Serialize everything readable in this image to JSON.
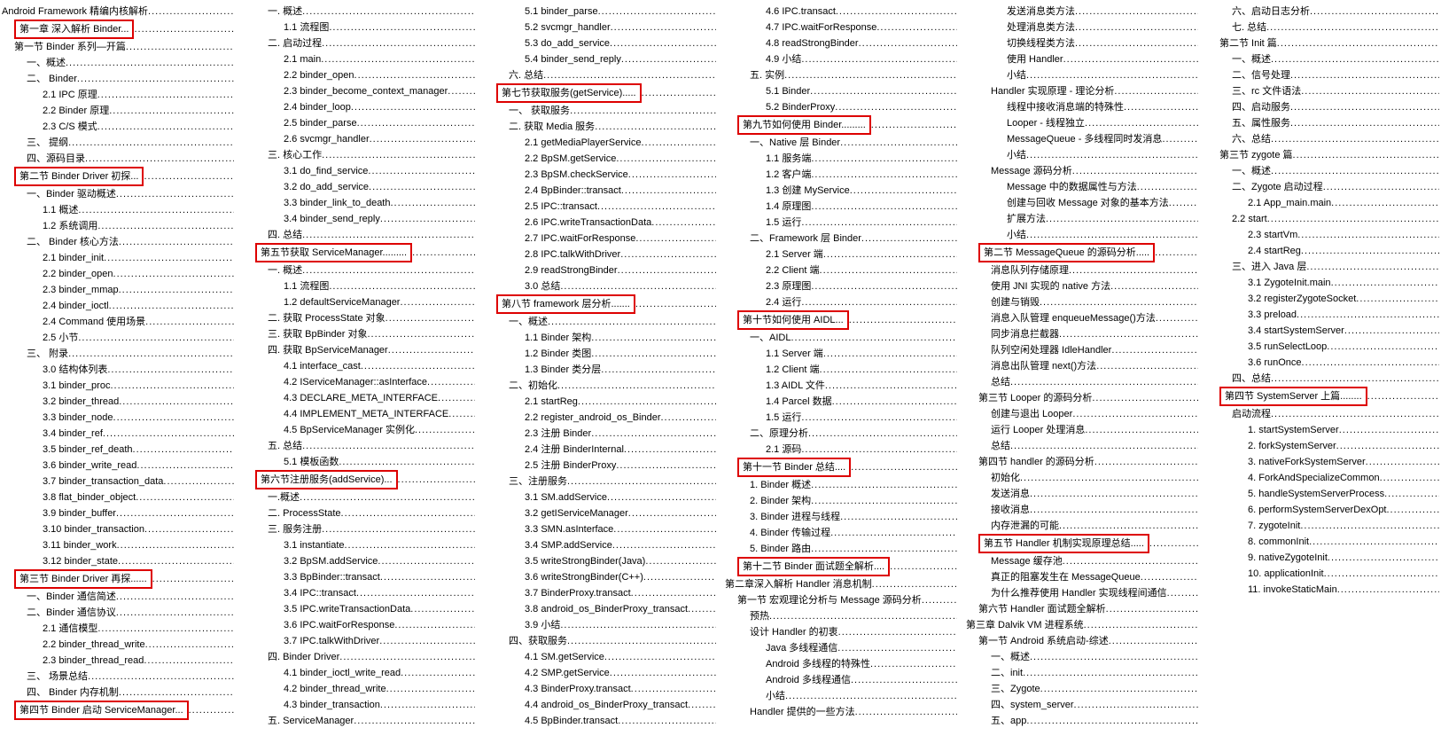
{
  "toc": [
    {
      "t": "Android Framework  精编内核解析",
      "i": 0,
      "h": 0
    },
    {
      "t": "第一章 深入解析 Binder...",
      "i": 1,
      "h": 1
    },
    {
      "t": "第一节 Binder 系列—开篇",
      "i": 1,
      "h": 0
    },
    {
      "t": "一、概述",
      "i": 2,
      "h": 0
    },
    {
      "t": "二、 Binder",
      "i": 2,
      "h": 0
    },
    {
      "t": "2.1 IPC 原理",
      "i": 3,
      "h": 0
    },
    {
      "t": "2.2 Binder 原理",
      "i": 3,
      "h": 0
    },
    {
      "t": "2.3 C/S 模式",
      "i": 3,
      "h": 0
    },
    {
      "t": "三、 提纲",
      "i": 2,
      "h": 0
    },
    {
      "t": "四、源码目录",
      "i": 2,
      "h": 0
    },
    {
      "t": "第二节 Binder Driver 初探...",
      "i": 1,
      "h": 1
    },
    {
      "t": "一、Binder 驱动概述",
      "i": 2,
      "h": 0
    },
    {
      "t": "1.1 概述",
      "i": 3,
      "h": 0
    },
    {
      "t": "1.2  系统调用",
      "i": 3,
      "h": 0
    },
    {
      "t": "二、 Binder 核心方法",
      "i": 2,
      "h": 0
    },
    {
      "t": "2.1 binder_init",
      "i": 3,
      "h": 0
    },
    {
      "t": "2.2 binder_open",
      "i": 3,
      "h": 0
    },
    {
      "t": "2.3 binder_mmap",
      "i": 3,
      "h": 0
    },
    {
      "t": "2.4 binder_ioctl",
      "i": 3,
      "h": 0
    },
    {
      "t": "2.4 Command 使用场景",
      "i": 3,
      "h": 0
    },
    {
      "t": "2.5  小节",
      "i": 3,
      "h": 0
    },
    {
      "t": "三、 附录",
      "i": 2,
      "h": 0
    },
    {
      "t": "3.0 结构体列表",
      "i": 3,
      "h": 0
    },
    {
      "t": "3.1 binder_proc",
      "i": 3,
      "h": 0
    },
    {
      "t": "3.2 binder_thread",
      "i": 3,
      "h": 0
    },
    {
      "t": "3.3 binder_node",
      "i": 3,
      "h": 0
    },
    {
      "t": "3.4 binder_ref",
      "i": 3,
      "h": 0
    },
    {
      "t": "3.5 binder_ref_death",
      "i": 3,
      "h": 0
    },
    {
      "t": "3.6 binder_write_read",
      "i": 3,
      "h": 0
    },
    {
      "t": "3.7 binder_transaction_data",
      "i": 3,
      "h": 0
    },
    {
      "t": "3.8 flat_binder_object",
      "i": 3,
      "h": 0
    },
    {
      "t": "3.9 binder_buffer",
      "i": 3,
      "h": 0
    },
    {
      "t": "3.10 binder_transaction",
      "i": 3,
      "h": 0
    },
    {
      "t": "3.11 binder_work",
      "i": 3,
      "h": 0
    },
    {
      "t": "3.12 binder_state",
      "i": 3,
      "h": 0
    },
    {
      "t": "第三节 Binder Driver 再探......",
      "i": 1,
      "h": 1
    },
    {
      "t": "一、Binder 通信简述",
      "i": 2,
      "h": 0
    },
    {
      "t": "二、Binder 通信协议",
      "i": 2,
      "h": 0
    },
    {
      "t": "2.1 通信模型",
      "i": 3,
      "h": 0
    },
    {
      "t": "2.2 binder_thread_write",
      "i": 3,
      "h": 0
    },
    {
      "t": "2.3 binder_thread_read",
      "i": 3,
      "h": 0
    },
    {
      "t": "三、 场景总结",
      "i": 2,
      "h": 0
    },
    {
      "t": "四、 Binder 内存机制",
      "i": 2,
      "h": 0
    },
    {
      "t": "第四节 Binder 启动 ServiceManager...",
      "i": 1,
      "h": 1
    },
    {
      "t": "一. 概述",
      "i": 2,
      "h": 0
    },
    {
      "t": "1.1 流程图",
      "i": 3,
      "h": 0
    },
    {
      "t": "二. 启动过程",
      "i": 2,
      "h": 0
    },
    {
      "t": "2.1 main",
      "i": 3,
      "h": 0
    },
    {
      "t": "2.2 binder_open",
      "i": 3,
      "h": 0
    },
    {
      "t": "2.3 binder_become_context_manager",
      "i": 3,
      "h": 0
    },
    {
      "t": "2.4 binder_loop",
      "i": 3,
      "h": 0
    },
    {
      "t": "2.5 binder_parse",
      "i": 3,
      "h": 0
    },
    {
      "t": "2.6 svcmgr_handler",
      "i": 3,
      "h": 0
    },
    {
      "t": "三. 核心工作",
      "i": 2,
      "h": 0
    },
    {
      "t": "3.1 do_find_service",
      "i": 3,
      "h": 0
    },
    {
      "t": "3.2 do_add_service",
      "i": 3,
      "h": 0
    },
    {
      "t": "3.3 binder_link_to_death",
      "i": 3,
      "h": 0
    },
    {
      "t": "3.4 binder_send_reply",
      "i": 3,
      "h": 0
    },
    {
      "t": "四. 总结",
      "i": 2,
      "h": 0
    },
    {
      "t": "第五节获取 ServiceManager.........",
      "i": 1,
      "h": 1
    },
    {
      "t": "一. 概述",
      "i": 2,
      "h": 0
    },
    {
      "t": "1.1 流程图",
      "i": 3,
      "h": 0
    },
    {
      "t": "1.2 defaultServiceManager",
      "i": 3,
      "h": 0
    },
    {
      "t": "二. 获取 ProcessState 对象",
      "i": 2,
      "h": 0
    },
    {
      "t": "三. 获取 BpBinder 对象",
      "i": 2,
      "h": 0
    },
    {
      "t": "四. 获取 BpServiceManager",
      "i": 2,
      "h": 0
    },
    {
      "t": "4.1 interface_cast",
      "i": 3,
      "h": 0
    },
    {
      "t": "4.2 IServiceManager::asInterface",
      "i": 3,
      "h": 0
    },
    {
      "t": "4.3 DECLARE_META_INTERFACE",
      "i": 3,
      "h": 0
    },
    {
      "t": "4.4 IMPLEMENT_META_INTERFACE",
      "i": 3,
      "h": 0
    },
    {
      "t": "4.5 BpServiceManager 实例化",
      "i": 3,
      "h": 0
    },
    {
      "t": "五. 总结",
      "i": 2,
      "h": 0
    },
    {
      "t": "5.1 模板函数",
      "i": 3,
      "h": 0
    },
    {
      "t": "第六节注册服务(addService)...",
      "i": 1,
      "h": 1
    },
    {
      "t": "一.概述",
      "i": 2,
      "h": 0
    },
    {
      "t": "二. ProcessState",
      "i": 2,
      "h": 0
    },
    {
      "t": "三. 服务注册",
      "i": 2,
      "h": 0
    },
    {
      "t": "3.1 instantiate",
      "i": 3,
      "h": 0
    },
    {
      "t": "3.2 BpSM.addService",
      "i": 3,
      "h": 0
    },
    {
      "t": "3.3 BpBinder::transact",
      "i": 3,
      "h": 0
    },
    {
      "t": "3.4 IPC::transact",
      "i": 3,
      "h": 0
    },
    {
      "t": "3.5 IPC.writeTransactionData",
      "i": 3,
      "h": 0
    },
    {
      "t": "3.6 IPC.waitForResponse",
      "i": 3,
      "h": 0
    },
    {
      "t": "3.7 IPC.talkWithDriver",
      "i": 3,
      "h": 0
    },
    {
      "t": "四. Binder Driver",
      "i": 2,
      "h": 0
    },
    {
      "t": "4.1 binder_ioctl_write_read",
      "i": 3,
      "h": 0
    },
    {
      "t": "4.2 binder_thread_write",
      "i": 3,
      "h": 0
    },
    {
      "t": "4.3 binder_transaction",
      "i": 3,
      "h": 0
    },
    {
      "t": "五. ServiceManager",
      "i": 2,
      "h": 0
    },
    {
      "t": "5.1 binder_parse",
      "i": 3,
      "h": 0
    },
    {
      "t": "5.2 svcmgr_handler",
      "i": 3,
      "h": 0
    },
    {
      "t": "5.3 do_add_service",
      "i": 3,
      "h": 0
    },
    {
      "t": "5.4 binder_send_reply",
      "i": 3,
      "h": 0
    },
    {
      "t": "六. 总结",
      "i": 2,
      "h": 0
    },
    {
      "t": "第七节获取服务(getService).....",
      "i": 1,
      "h": 1
    },
    {
      "t": "一、 获取服务",
      "i": 2,
      "h": 0
    },
    {
      "t": "二. 获取 Media 服务",
      "i": 2,
      "h": 0
    },
    {
      "t": "2.1 getMediaPlayerService",
      "i": 3,
      "h": 0
    },
    {
      "t": "2.2 BpSM.getService",
      "i": 3,
      "h": 0
    },
    {
      "t": "2.3 BpSM.checkService",
      "i": 3,
      "h": 0
    },
    {
      "t": "2.4 BpBinder::transact",
      "i": 3,
      "h": 0
    },
    {
      "t": "2.5 IPC::transact",
      "i": 3,
      "h": 0
    },
    {
      "t": "2.6 IPC.writeTransactionData",
      "i": 3,
      "h": 0
    },
    {
      "t": "2.7 IPC.waitForResponse",
      "i": 3,
      "h": 0
    },
    {
      "t": "2.8 IPC.talkWithDriver",
      "i": 3,
      "h": 0
    },
    {
      "t": "2.9 readStrongBinder",
      "i": 3,
      "h": 0
    },
    {
      "t": "3.0  总结",
      "i": 3,
      "h": 0
    },
    {
      "t": "第八节 framework 层分析.......",
      "i": 1,
      "h": 1
    },
    {
      "t": "一、概述",
      "i": 2,
      "h": 0
    },
    {
      "t": "1.1 Binder 架构",
      "i": 3,
      "h": 0
    },
    {
      "t": "1.2 Binder 类图",
      "i": 3,
      "h": 0
    },
    {
      "t": "1.3 Binder 类分层",
      "i": 3,
      "h": 0
    },
    {
      "t": "二、初始化",
      "i": 2,
      "h": 0
    },
    {
      "t": "2.1 startReg",
      "i": 3,
      "h": 0
    },
    {
      "t": "2.2 register_android_os_Binder",
      "i": 3,
      "h": 0
    },
    {
      "t": "2.3 注册 Binder",
      "i": 3,
      "h": 0
    },
    {
      "t": "2.4 注册 BinderInternal",
      "i": 3,
      "h": 0
    },
    {
      "t": "2.5 注册 BinderProxy",
      "i": 3,
      "h": 0
    },
    {
      "t": "三、注册服务",
      "i": 2,
      "h": 0
    },
    {
      "t": "3.1 SM.addService",
      "i": 3,
      "h": 0
    },
    {
      "t": "3.2 getIServiceManager",
      "i": 3,
      "h": 0
    },
    {
      "t": "3.3 SMN.asInterface",
      "i": 3,
      "h": 0
    },
    {
      "t": "3.4 SMP.addService",
      "i": 3,
      "h": 0
    },
    {
      "t": "3.5 writeStrongBinder(Java)",
      "i": 3,
      "h": 0
    },
    {
      "t": "3.6 writeStrongBinder(C++)",
      "i": 3,
      "h": 0
    },
    {
      "t": "3.7 BinderProxy.transact",
      "i": 3,
      "h": 0
    },
    {
      "t": "3.8 android_os_BinderProxy_transact",
      "i": 3,
      "h": 0
    },
    {
      "t": "3.9 小结",
      "i": 3,
      "h": 0
    },
    {
      "t": "四、获取服务",
      "i": 2,
      "h": 0
    },
    {
      "t": "4.1 SM.getService",
      "i": 3,
      "h": 0
    },
    {
      "t": "4.2 SMP.getService",
      "i": 3,
      "h": 0
    },
    {
      "t": "4.3 BinderProxy.transact",
      "i": 3,
      "h": 0
    },
    {
      "t": "4.4 android_os_BinderProxy_transact",
      "i": 3,
      "h": 0
    },
    {
      "t": "4.5 BpBinder.transact",
      "i": 3,
      "h": 0
    },
    {
      "t": "4.6 IPC.transact",
      "i": 3,
      "h": 0
    },
    {
      "t": "4.7 IPC.waitForResponse",
      "i": 3,
      "h": 0
    },
    {
      "t": "4.8 readStrongBinder",
      "i": 3,
      "h": 0
    },
    {
      "t": "4.9 小结",
      "i": 3,
      "h": 0
    },
    {
      "t": "五. 实例",
      "i": 2,
      "h": 0
    },
    {
      "t": "5.1 Binder",
      "i": 3,
      "h": 0
    },
    {
      "t": "5.2 BinderProxy",
      "i": 3,
      "h": 0
    },
    {
      "t": "第九节如何使用 Binder.........",
      "i": 1,
      "h": 1
    },
    {
      "t": "一、Native 层 Binder",
      "i": 2,
      "h": 0
    },
    {
      "t": "1.1 服务端",
      "i": 3,
      "h": 0
    },
    {
      "t": "1.2 客户端",
      "i": 3,
      "h": 0
    },
    {
      "t": "1.3 创建 MyService",
      "i": 3,
      "h": 0
    },
    {
      "t": "1.4 原理图",
      "i": 3,
      "h": 0
    },
    {
      "t": "1.5 运行",
      "i": 3,
      "h": 0
    },
    {
      "t": "二、Framework 层 Binder",
      "i": 2,
      "h": 0
    },
    {
      "t": "2.1 Server 端",
      "i": 3,
      "h": 0
    },
    {
      "t": "2.2 Client 端",
      "i": 3,
      "h": 0
    },
    {
      "t": "2.3 原理图",
      "i": 3,
      "h": 0
    },
    {
      "t": "2.4 运行",
      "i": 3,
      "h": 0
    },
    {
      "t": "第十节如何使用 AIDL...",
      "i": 1,
      "h": 1
    },
    {
      "t": "一、AIDL",
      "i": 2,
      "h": 0
    },
    {
      "t": "1.1 Server 端",
      "i": 3,
      "h": 0
    },
    {
      "t": "1.2 Client 端",
      "i": 3,
      "h": 0
    },
    {
      "t": "1.3 AIDL 文件",
      "i": 3,
      "h": 0
    },
    {
      "t": "1.4 Parcel 数据",
      "i": 3,
      "h": 0
    },
    {
      "t": "1.5 运行",
      "i": 3,
      "h": 0
    },
    {
      "t": "二、原理分析",
      "i": 2,
      "h": 0
    },
    {
      "t": "2.1 源码",
      "i": 3,
      "h": 0
    },
    {
      "t": "第十一节 Binder 总结....",
      "i": 1,
      "h": 1
    },
    {
      "t": "1. Binder 概述",
      "i": 2,
      "h": 0
    },
    {
      "t": "2. Binder 架构",
      "i": 2,
      "h": 0
    },
    {
      "t": "3. Binder 进程与线程",
      "i": 2,
      "h": 0
    },
    {
      "t": "4. Binder 传输过程",
      "i": 2,
      "h": 0
    },
    {
      "t": "5. Binder 路由",
      "i": 2,
      "h": 0
    },
    {
      "t": "第十二节  Binder 面试题全解析....",
      "i": 1,
      "h": 1
    },
    {
      "t": "第二章深入解析 Handler 消息机制",
      "i": 0,
      "h": 0
    },
    {
      "t": "第一节 宏观理论分析与 Message 源码分析",
      "i": 1,
      "h": 0
    },
    {
      "t": "预热",
      "i": 2,
      "h": 0
    },
    {
      "t": "设计 Handler 的初衷",
      "i": 2,
      "h": 0
    },
    {
      "t": "Java 多线程通信",
      "i": 3,
      "h": 0
    },
    {
      "t": "Android 多线程的特殊性",
      "i": 3,
      "h": 0
    },
    {
      "t": "Android 多线程通信",
      "i": 3,
      "h": 0
    },
    {
      "t": "小结",
      "i": 3,
      "h": 0
    },
    {
      "t": "Handler 提供的一些方法",
      "i": 2,
      "h": 0
    },
    {
      "t": "发送消息类方法",
      "i": 3,
      "h": 0
    },
    {
      "t": "处理消息类方法",
      "i": 3,
      "h": 0
    },
    {
      "t": "切换线程类方法",
      "i": 3,
      "h": 0
    },
    {
      "t": "使用 Handler",
      "i": 3,
      "h": 0
    },
    {
      "t": "小结",
      "i": 3,
      "h": 0
    },
    {
      "t": "Handler 实现原理 - 理论分析",
      "i": 2,
      "h": 0
    },
    {
      "t": "线程中接收消息端的特殊性",
      "i": 3,
      "h": 0
    },
    {
      "t": "Looper - 线程独立",
      "i": 3,
      "h": 0
    },
    {
      "t": "MessageQueue - 多线程同时发消息",
      "i": 3,
      "h": 0
    },
    {
      "t": "小结",
      "i": 3,
      "h": 0
    },
    {
      "t": "Message 源码分析",
      "i": 2,
      "h": 0
    },
    {
      "t": "Message 中的数据属性与方法",
      "i": 3,
      "h": 0
    },
    {
      "t": "创建与回收 Message 对象的基本方法",
      "i": 3,
      "h": 0
    },
    {
      "t": "扩展方法",
      "i": 3,
      "h": 0
    },
    {
      "t": "小结",
      "i": 3,
      "h": 0
    },
    {
      "t": "第二节 MessageQueue 的源码分析.....",
      "i": 1,
      "h": 1
    },
    {
      "t": "消息队列存储原理",
      "i": 2,
      "h": 0
    },
    {
      "t": "使用 JNI 实现的 native 方法",
      "i": 2,
      "h": 0
    },
    {
      "t": "创建与销毁",
      "i": 2,
      "h": 0
    },
    {
      "t": "消息入队管理 enqueueMessage()方法",
      "i": 2,
      "h": 0
    },
    {
      "t": "同步消息拦截器",
      "i": 2,
      "h": 0
    },
    {
      "t": "队列空闲处理器 IdleHandler",
      "i": 2,
      "h": 0
    },
    {
      "t": "消息出队管理 next()方法",
      "i": 2,
      "h": 0
    },
    {
      "t": "总结",
      "i": 2,
      "h": 0
    },
    {
      "t": "第三节 Looper 的源码分析",
      "i": 1,
      "h": 0
    },
    {
      "t": "创建与退出 Looper",
      "i": 2,
      "h": 0
    },
    {
      "t": "运行 Looper 处理消息",
      "i": 2,
      "h": 0
    },
    {
      "t": "总结",
      "i": 2,
      "h": 0
    },
    {
      "t": "第四节 handler 的源码分析",
      "i": 1,
      "h": 0
    },
    {
      "t": "初始化",
      "i": 2,
      "h": 0
    },
    {
      "t": "发送消息",
      "i": 2,
      "h": 0
    },
    {
      "t": "接收消息",
      "i": 2,
      "h": 0
    },
    {
      "t": "内存泄漏的可能",
      "i": 2,
      "h": 0
    },
    {
      "t": "第五节 Handler 机制实现原理总结.....",
      "i": 1,
      "h": 1
    },
    {
      "t": "Message 缓存池",
      "i": 2,
      "h": 0
    },
    {
      "t": "真正的阻塞发生在 MessageQueue",
      "i": 2,
      "h": 0
    },
    {
      "t": "为什么推荐使用 Handler 实现线程间通信",
      "i": 2,
      "h": 0
    },
    {
      "t": "第六节 Handler 面试题全解析",
      "i": 1,
      "h": 0
    },
    {
      "t": "第三章 Dalvik VM 进程系统",
      "i": 0,
      "h": 0
    },
    {
      "t": "第一节 Android 系统启动-综述",
      "i": 1,
      "h": 0
    },
    {
      "t": "一、概述",
      "i": 2,
      "h": 0
    },
    {
      "t": "二、init",
      "i": 2,
      "h": 0
    },
    {
      "t": "三、Zygote",
      "i": 2,
      "h": 0
    },
    {
      "t": "四、system_server",
      "i": 2,
      "h": 0
    },
    {
      "t": "五、app",
      "i": 2,
      "h": 0
    },
    {
      "t": "六、启动日志分析",
      "i": 2,
      "h": 0
    },
    {
      "t": "七. 总结",
      "i": 2,
      "h": 0
    },
    {
      "t": "第二节 Init 篇",
      "i": 1,
      "h": 0
    },
    {
      "t": "一、概述",
      "i": 2,
      "h": 0
    },
    {
      "t": "二、信号处理",
      "i": 2,
      "h": 0
    },
    {
      "t": "三、rc 文件语法",
      "i": 2,
      "h": 0
    },
    {
      "t": "四、启动服务",
      "i": 2,
      "h": 0
    },
    {
      "t": "五、属性服务",
      "i": 2,
      "h": 0
    },
    {
      "t": "六、总结",
      "i": 2,
      "h": 0
    },
    {
      "t": "第三节 zygote 篇",
      "i": 1,
      "h": 0
    },
    {
      "t": "一、概述",
      "i": 2,
      "h": 0
    },
    {
      "t": "二、Zygote 启动过程",
      "i": 2,
      "h": 0
    },
    {
      "t": "2.1 App_main.main",
      "i": 3,
      "h": 0
    },
    {
      "t": "2.2 start",
      "i": 2,
      "h": 0
    },
    {
      "t": "2.3 startVm",
      "i": 3,
      "h": 0
    },
    {
      "t": "2.4 startReg",
      "i": 3,
      "h": 0
    },
    {
      "t": "三、进入 Java 层",
      "i": 2,
      "h": 0
    },
    {
      "t": "3.1 ZygoteInit.main",
      "i": 3,
      "h": 0
    },
    {
      "t": "3.2 registerZygoteSocket",
      "i": 3,
      "h": 0
    },
    {
      "t": "3.3 preload",
      "i": 3,
      "h": 0
    },
    {
      "t": "3.4 startSystemServer",
      "i": 3,
      "h": 0
    },
    {
      "t": "3.5 runSelectLoop",
      "i": 3,
      "h": 0
    },
    {
      "t": "3.6 runOnce",
      "i": 3,
      "h": 0
    },
    {
      "t": "四、总结",
      "i": 2,
      "h": 0
    },
    {
      "t": "第四节 SystemServer 上篇........",
      "i": 1,
      "h": 1
    },
    {
      "t": "启动流程",
      "i": 2,
      "h": 0
    },
    {
      "t": "1. startSystemServer",
      "i": 3,
      "h": 0
    },
    {
      "t": "2. forkSystemServer",
      "i": 3,
      "h": 0
    },
    {
      "t": "3. nativeForkSystemServer",
      "i": 3,
      "h": 0
    },
    {
      "t": "4. ForkAndSpecializeCommon",
      "i": 3,
      "h": 0
    },
    {
      "t": "5. handleSystemServerProcess",
      "i": 3,
      "h": 0
    },
    {
      "t": "6. performSystemServerDexOpt",
      "i": 3,
      "h": 0
    },
    {
      "t": "7. zygoteInit",
      "i": 3,
      "h": 0
    },
    {
      "t": "8. commonInit",
      "i": 3,
      "h": 0
    },
    {
      "t": "9. nativeZygoteInit",
      "i": 3,
      "h": 0
    },
    {
      "t": "10. applicationInit",
      "i": 3,
      "h": 0
    },
    {
      "t": "11. invokeStaticMain",
      "i": 3,
      "h": 0
    }
  ]
}
